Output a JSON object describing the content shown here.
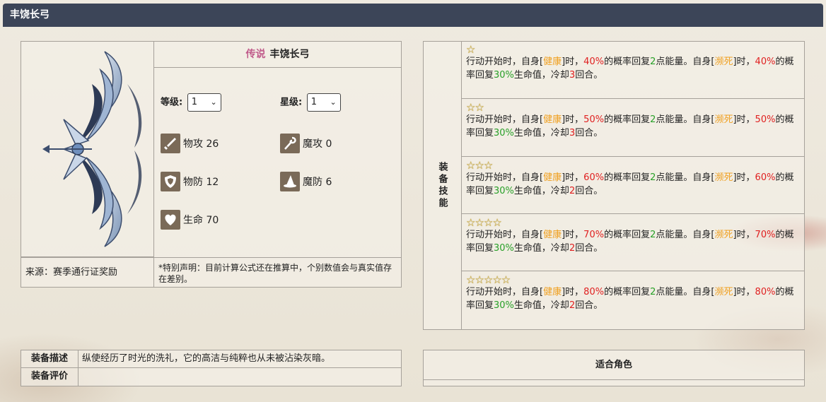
{
  "header": {
    "title": "丰饶长弓"
  },
  "item": {
    "rarity": "传说",
    "name": "丰饶长弓",
    "level_label": "等级:",
    "level_value": "1",
    "star_label": "星级:",
    "star_value": "1",
    "stats": [
      {
        "name": "物攻 26",
        "icon": "sword-icon"
      },
      {
        "name": "魔攻 0",
        "icon": "staff-icon"
      },
      {
        "name": "物防 12",
        "icon": "shield-icon"
      },
      {
        "name": "魔防 6",
        "icon": "wizard-hat-icon"
      },
      {
        "name": "生命 70",
        "icon": "heart-icon"
      }
    ],
    "source": "来源：赛季通行证奖励",
    "note": "*特别声明：目前计算公式还在推算中，个别数值会与真实值存在差别。"
  },
  "skills": {
    "label": "装备技能",
    "rows": [
      {
        "stars": "☆",
        "chance": "40%",
        "cooldown": "3"
      },
      {
        "stars": "☆☆",
        "chance": "50%",
        "cooldown": "3"
      },
      {
        "stars": "☆☆☆",
        "chance": "60%",
        "cooldown": "2"
      },
      {
        "stars": "☆☆☆☆",
        "chance": "70%",
        "cooldown": "2"
      },
      {
        "stars": "☆☆☆☆☆",
        "chance": "80%",
        "cooldown": "2"
      }
    ],
    "text": {
      "p1": "行动开始时，自身[",
      "healthy": "健康",
      "p2": "]时，",
      "p3": "的概率回复",
      "energy": "2",
      "p4": "点能量。自身[",
      "dying": "濒死",
      "p5": "]时，",
      "p6": "的概率回复",
      "hp": "30%",
      "p7": "生命值，冷却",
      "p8": "回合。"
    }
  },
  "bottom": {
    "desc_label": "装备描述",
    "desc_text": "纵使经历了时光的洗礼，它的高洁与纯粹也从未被沾染灰暗。",
    "eval_label": "装备评价",
    "eval_text": "",
    "fit_title": "适合角色"
  },
  "colors": {
    "header": "#3c4558",
    "red": "#e02020",
    "orange": "#f0a020",
    "green": "#28a028"
  }
}
